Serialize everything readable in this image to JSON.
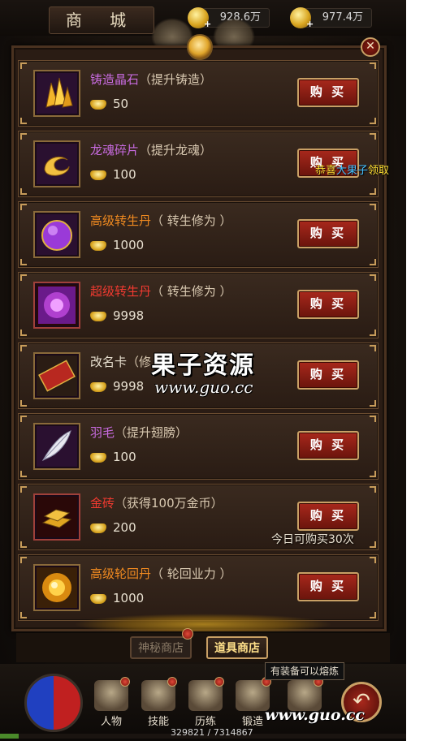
{
  "header": {
    "title": "商 城"
  },
  "currencies": [
    {
      "icon": "gold-coin-icon",
      "value": "928.6万"
    },
    {
      "icon": "ingot-icon",
      "value": "977.4万"
    }
  ],
  "items": [
    {
      "name": "铸造晶石",
      "desc": "（提升铸造）",
      "price": "50",
      "buy_label": "购 买",
      "icon": "crystal-icon"
    },
    {
      "name": "龙魂碎片",
      "desc": "（提升龙魂）",
      "price": "100",
      "buy_label": "购 买",
      "icon": "dragon-soul-icon"
    },
    {
      "name": "高级转生丹",
      "desc": "（ 转生修为 ）",
      "price": "1000",
      "buy_label": "购 买",
      "icon": "purple-pill-icon"
    },
    {
      "name": "超级转生丹",
      "desc": "（ 转生修为 ）",
      "price": "9998",
      "buy_label": "购 买",
      "icon": "super-pill-icon"
    },
    {
      "name": "改名卡",
      "desc": "（修",
      "price": "9998",
      "buy_label": "购 买",
      "icon": "rename-card-icon"
    },
    {
      "name": "羽毛",
      "desc": "（提升翅膀）",
      "price": "100",
      "buy_label": "购 买",
      "icon": "feather-icon"
    },
    {
      "name": "金砖",
      "desc": "（获得100万金币）",
      "price": "200",
      "buy_label": "购 买",
      "icon": "gold-brick-icon"
    },
    {
      "name": "高级轮回丹",
      "desc": "（ 轮回业力 ）",
      "price": "1000",
      "buy_label": "购 买",
      "icon": "reincarnation-pill-icon"
    }
  ],
  "limit_text": "今日可购买30次",
  "tabs": [
    {
      "label": "神秘商店",
      "active": false
    },
    {
      "label": "道具商店",
      "active": true
    }
  ],
  "hud": {
    "buttons": [
      {
        "label": "人物"
      },
      {
        "label": "技能"
      },
      {
        "label": "历练"
      },
      {
        "label": "锻造"
      }
    ],
    "tooltip": "有装备可以熔炼",
    "exp_text": "329821 / 7314867",
    "exp_fraction": 0.045
  },
  "notice": {
    "prefix": "恭喜",
    "highlight": "大果子",
    "suffix": "领取"
  },
  "watermark": {
    "main": "果子资源",
    "url": "www.guo.cc",
    "url2": "www.guo.cc"
  },
  "colors": {
    "buy_button": "#a8281c",
    "price_gold": "#d9a520",
    "name_purple": "#c86be0",
    "name_orange": "#f08a20",
    "name_red": "#f03a30"
  }
}
